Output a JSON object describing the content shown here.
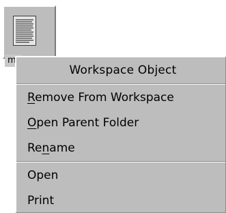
{
  "desktop_icon": {
    "label": "m",
    "icon": "document-icon"
  },
  "context_menu": {
    "title": "Workspace Object",
    "groups": [
      [
        {
          "pre": "",
          "mnemonic": "R",
          "post": "emove From Workspace"
        },
        {
          "pre": "",
          "mnemonic": "O",
          "post": "pen Parent Folder"
        },
        {
          "pre": "Re",
          "mnemonic": "n",
          "post": "ame"
        }
      ],
      [
        {
          "pre": "Open",
          "mnemonic": "",
          "post": ""
        },
        {
          "pre": "Print",
          "mnemonic": "",
          "post": ""
        }
      ]
    ]
  },
  "colors": {
    "menu_bg": "#bdbdbd",
    "text": "#000000"
  }
}
